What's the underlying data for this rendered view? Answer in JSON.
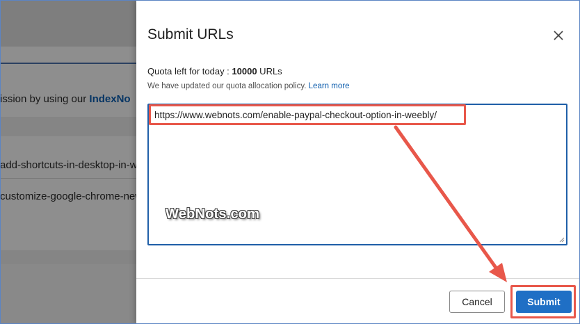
{
  "background": {
    "lines": [
      {
        "prefix": "ission by using our ",
        "link": "IndexNo"
      },
      {
        "prefix": "add-shortcuts-in-desktop-in-wi",
        "link": ""
      },
      {
        "prefix": "customize-google-chrome-new",
        "link": ""
      }
    ]
  },
  "dialog": {
    "title": "Submit URLs",
    "quota_label": "Quota left for today : ",
    "quota_value": "10000",
    "quota_unit": " URLs",
    "policy_text": "We have updated our quota allocation policy.",
    "learn_more": "Learn more",
    "url_value": "https://www.webnots.com/enable-paypal-checkout-option-in-weebly/",
    "cancel_label": "Cancel",
    "submit_label": "Submit"
  },
  "watermark": "WebNots.com",
  "colors": {
    "accent": "#1f6fc5",
    "highlight": "#e8574a",
    "link": "#0b5cad"
  }
}
